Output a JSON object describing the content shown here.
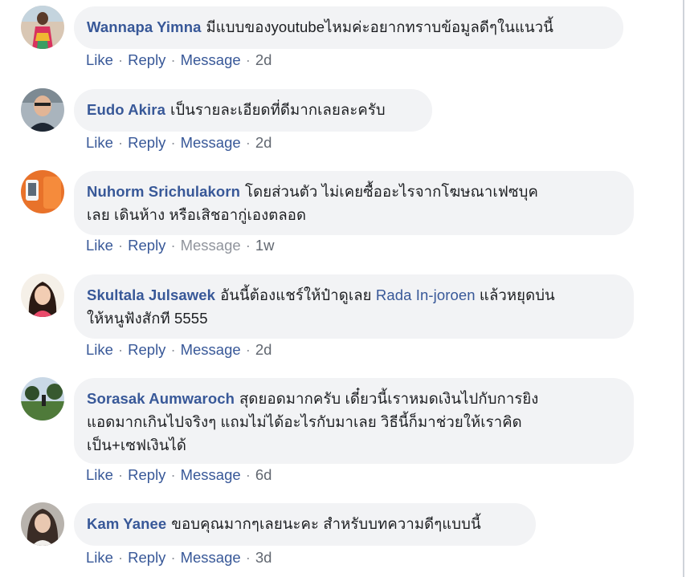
{
  "comments": [
    {
      "author": "Wannapa Yimna",
      "text": "มีแบบของyoutubeไหมค่ะอยากทราบข้อมูลดีๆในแนวนี้",
      "actions": [
        "Like",
        "Reply",
        "Message"
      ],
      "time": "2d"
    },
    {
      "author": "Eudo Akira",
      "text": "เป็นรายละเอียดที่ดีมากเลยละครับ",
      "actions": [
        "Like",
        "Reply",
        "Message"
      ],
      "time": "2d"
    },
    {
      "author": "Nuhorm Srichulakorn",
      "text_line1": "โดยส่วนตัว ไม่เคยซื้ออะไรจากโฆษณาเฟซบุค",
      "text_line2": "เลย เดินห้าง หรือเสิชอากู่เองตลอด",
      "actions": [
        "Like",
        "Reply",
        "Message"
      ],
      "time": "1w"
    },
    {
      "author": "Skultala Julsawek",
      "text_before_mention": "อันนี้ต้องแชร์ให้ป๋าดูเลย",
      "mention": "Rada In-joroen",
      "text_after_mention": "แล้วหยุดบ่น",
      "text_line2": "ให้หนูฟังสักที 5555",
      "actions": [
        "Like",
        "Reply",
        "Message"
      ],
      "time": "2d"
    },
    {
      "author": "Sorasak Aumwaroch",
      "text_line1": "สุดยอดมากครับ เดี๋ยวนี้เราหมดเงินไปกับการยิง",
      "text_line2": "แอดมากเกินไปจริงๆ แถมไม่ได้อะไรกับมาเลย วิธีนี้ก็มาช่วยให้เราคิด",
      "text_line3": "เป็น+เซฟเงินได้",
      "actions": [
        "Like",
        "Reply",
        "Message"
      ],
      "time": "6d"
    },
    {
      "author": "Kam Yanee",
      "text": "ขอบคุณมากๆเลยนะคะ สำหรับบทความดีๆแบบนี้",
      "actions": [
        "Like",
        "Reply",
        "Message"
      ],
      "time": "3d"
    }
  ],
  "colors": {
    "link": "#385898",
    "bubble": "#f2f3f5",
    "text": "#1c1e21",
    "meta": "#616770"
  }
}
